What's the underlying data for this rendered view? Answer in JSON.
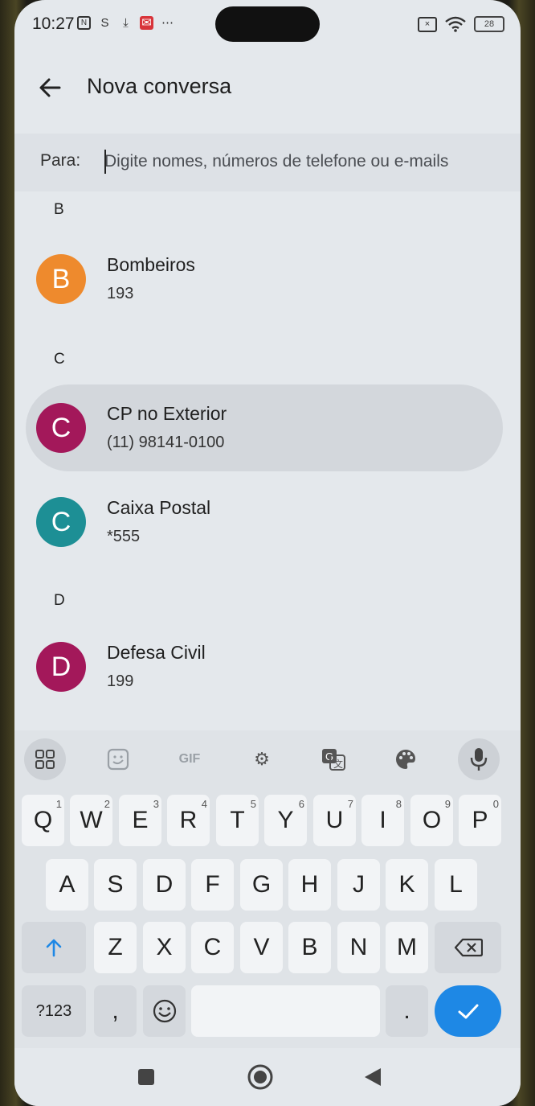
{
  "status": {
    "time": "10:27",
    "battery": "28"
  },
  "appbar": {
    "title": "Nova conversa"
  },
  "to": {
    "label": "Para:",
    "placeholder": "Digite nomes, números de telefone ou e-mails"
  },
  "sections": [
    {
      "letter": "B",
      "contacts": [
        {
          "initial": "B",
          "name": "Bombeiros",
          "number": "193",
          "color": "#ee8a2d"
        }
      ]
    },
    {
      "letter": "C",
      "contacts": [
        {
          "initial": "C",
          "name": "CP no Exterior",
          "number": "(11) 98141-0100",
          "color": "#a3185a"
        },
        {
          "initial": "C",
          "name": "Caixa Postal",
          "number": "*555",
          "color": "#1d8f95"
        }
      ]
    },
    {
      "letter": "D",
      "contacts": [
        {
          "initial": "D",
          "name": "Defesa Civil",
          "number": "199",
          "color": "#a3185a"
        }
      ]
    }
  ],
  "keyboard": {
    "tools": [
      "apps-grid-icon",
      "sticker-icon",
      "GIF",
      "settings-icon",
      "translate-icon",
      "palette-icon",
      "mic-icon"
    ],
    "row1": [
      [
        "Q",
        "1"
      ],
      [
        "W",
        "2"
      ],
      [
        "E",
        "3"
      ],
      [
        "R",
        "4"
      ],
      [
        "T",
        "5"
      ],
      [
        "Y",
        "6"
      ],
      [
        "U",
        "7"
      ],
      [
        "I",
        "8"
      ],
      [
        "O",
        "9"
      ],
      [
        "P",
        "0"
      ]
    ],
    "row2": [
      "A",
      "S",
      "D",
      "F",
      "G",
      "H",
      "J",
      "K",
      "L"
    ],
    "row3": [
      "Z",
      "X",
      "C",
      "V",
      "B",
      "N",
      "M"
    ],
    "symbols": "?123",
    "comma": ",",
    "period": "."
  },
  "colors": {
    "accent": "#1e88e5"
  }
}
